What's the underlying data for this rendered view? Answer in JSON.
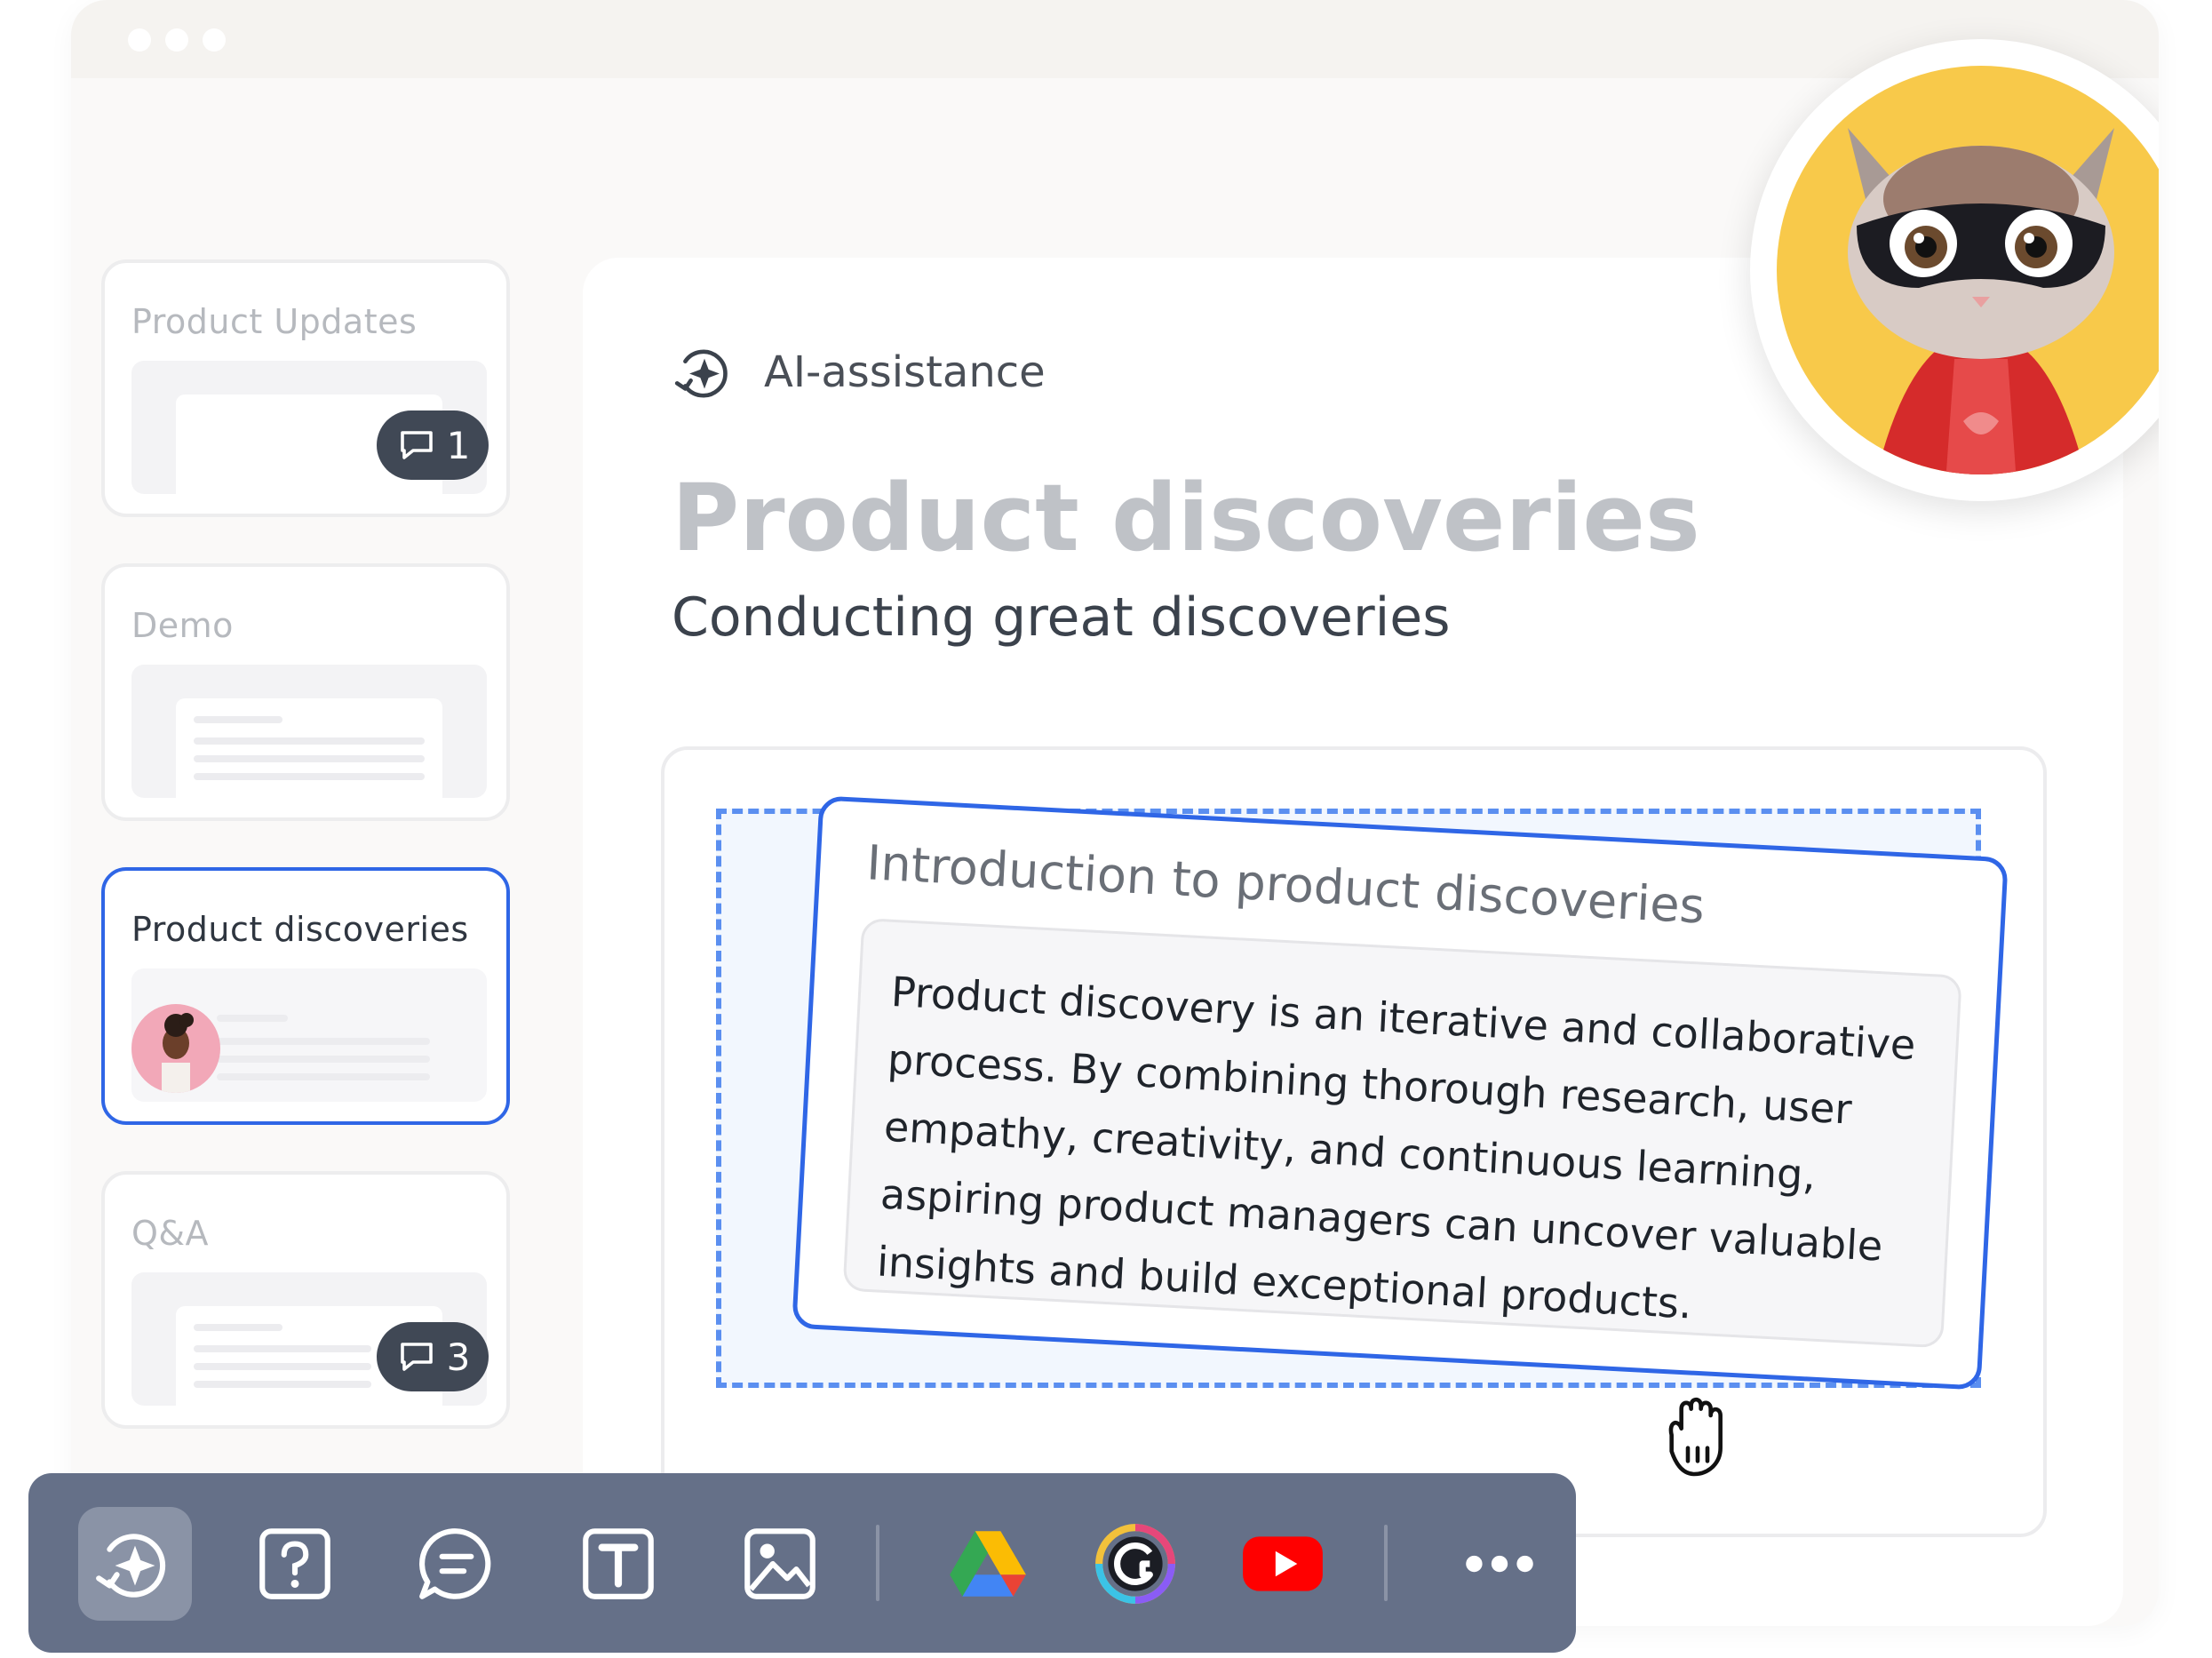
{
  "sidebar": {
    "cards": [
      {
        "title": "Product Updates",
        "comments": "1"
      },
      {
        "title": "Demo"
      },
      {
        "title": "Product discoveries"
      },
      {
        "title": "Q&A",
        "comments": "3"
      }
    ]
  },
  "main": {
    "ai_label": "AI-assistance",
    "title": "Product discoveries",
    "subtitle": "Conducting great discoveries",
    "block": {
      "title": "Introduction to product discoveries",
      "text": "Product discovery is an iterative and collaborative process. By combining thorough research, user empathy, creativity, and continuous learning, aspiring product managers can uncover valuable insights and build exceptional products."
    }
  },
  "toolbar": {
    "items": [
      "ai-assistance-icon",
      "quiz-icon",
      "comment-icon",
      "text-icon",
      "image-icon",
      "google-drive-icon",
      "miro-icon",
      "youtube-icon",
      "more-icon"
    ]
  },
  "colors": {
    "accent": "#2f66e6",
    "toolbar": "#657088",
    "badge": "#404855",
    "avatar_bg": "#f8c94a"
  }
}
